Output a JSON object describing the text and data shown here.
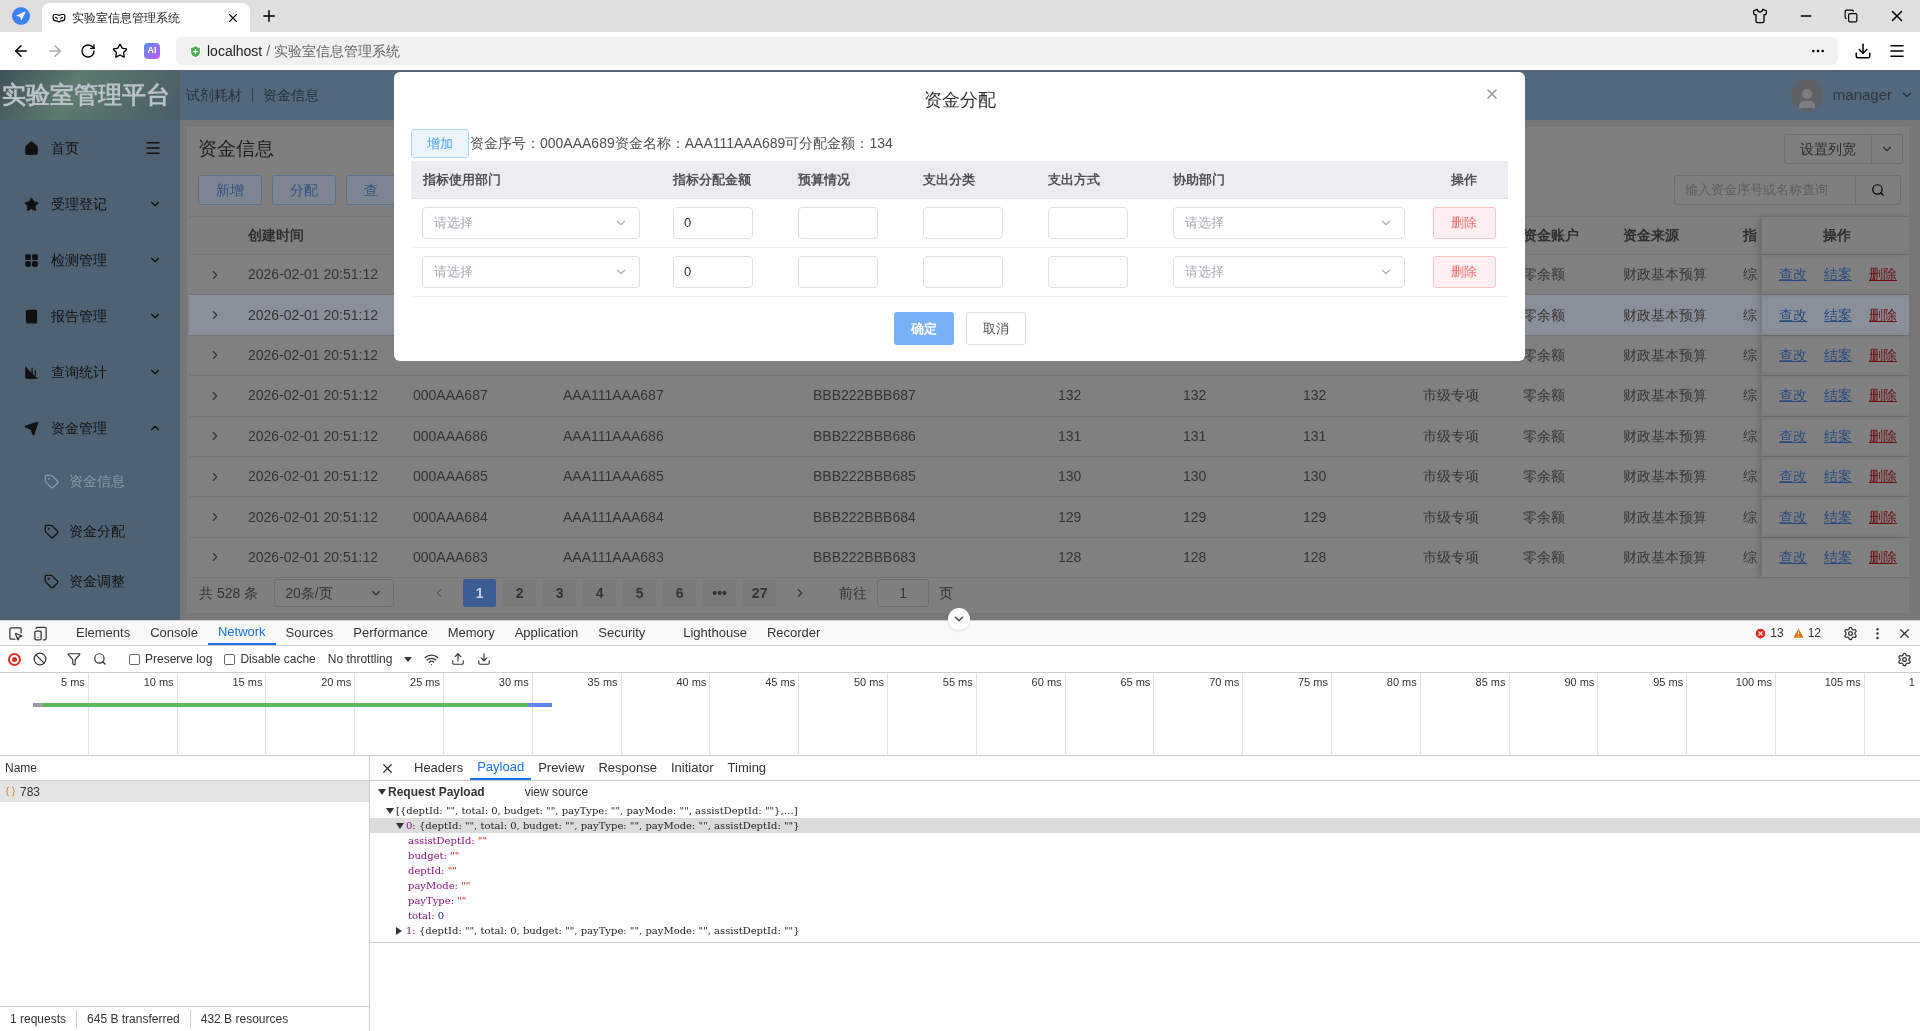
{
  "browser": {
    "tab_title": "实验室信息管理系统",
    "ai_badge": "AI",
    "address": {
      "host": "localhost",
      "path": " / 实验室信息管理系统"
    }
  },
  "app": {
    "logo": "实验室管理平台",
    "breadcrumbs": [
      "试剂耗材",
      "资金信息"
    ],
    "user": "manager",
    "sidebar": [
      {
        "label": "首页"
      },
      {
        "label": "受理登记",
        "expanded": false
      },
      {
        "label": "检测管理",
        "expanded": false
      },
      {
        "label": "报告管理",
        "expanded": false
      },
      {
        "label": "查询统计",
        "expanded": false
      },
      {
        "label": "资金管理",
        "expanded": true,
        "children": [
          {
            "label": "资金信息",
            "selected": true
          },
          {
            "label": "资金分配",
            "selected": false
          },
          {
            "label": "资金调整",
            "selected": false
          }
        ]
      }
    ],
    "page_title": "资金信息",
    "toolbar": [
      "新增",
      "分配",
      "查"
    ],
    "column_width_button": "设置列宽",
    "search": {
      "placeholder": "输入资金序号或名称查询"
    },
    "table": {
      "columns": [
        "创建时间",
        null,
        null,
        null,
        null,
        null,
        null,
        null,
        "资金账户",
        "资金来源",
        "指"
      ],
      "actions_header": "操作",
      "rows": [
        {
          "expanded": false,
          "highlighted": false,
          "cells": [
            "2026-02-01 20:51:12",
            null,
            null,
            null,
            null,
            null,
            null,
            null,
            "零余额",
            "财政基本预算",
            "综"
          ],
          "actions": [
            {
              "label": "查改",
              "kind": "link"
            },
            {
              "label": "结案",
              "kind": "link"
            },
            {
              "label": "删除",
              "kind": "danger"
            }
          ]
        },
        {
          "expanded": false,
          "highlighted": true,
          "cells": [
            "2026-02-01 20:51:12",
            null,
            null,
            null,
            null,
            null,
            null,
            null,
            "零余额",
            "财政基本预算",
            "综"
          ],
          "actions": [
            {
              "label": "查改",
              "kind": "link"
            },
            {
              "label": "结案",
              "kind": "link"
            },
            {
              "label": "删除",
              "kind": "danger"
            }
          ]
        },
        {
          "expanded": false,
          "highlighted": false,
          "cells": [
            "2026-02-01 20:51:12",
            null,
            null,
            null,
            null,
            null,
            null,
            null,
            "零余额",
            "财政基本预算",
            "综"
          ],
          "actions": [
            {
              "label": "查改",
              "kind": "link"
            },
            {
              "label": "结案",
              "kind": "link"
            },
            {
              "label": "删除",
              "kind": "danger"
            }
          ]
        },
        {
          "expanded": false,
          "highlighted": false,
          "cells": [
            "2026-02-01 20:51:12",
            "000AAA687",
            "AAA111AAA687",
            "BBB222BBB687",
            "132",
            "132",
            "132",
            "市级专项",
            "零余额",
            "财政基本预算",
            "综"
          ],
          "actions": [
            {
              "label": "查改",
              "kind": "link"
            },
            {
              "label": "结案",
              "kind": "link"
            },
            {
              "label": "删除",
              "kind": "danger"
            }
          ]
        },
        {
          "expanded": false,
          "highlighted": false,
          "cells": [
            "2026-02-01 20:51:12",
            "000AAA686",
            "AAA111AAA686",
            "BBB222BBB686",
            "131",
            "131",
            "131",
            "市级专项",
            "零余额",
            "财政基本预算",
            "综"
          ],
          "actions": [
            {
              "label": "查改",
              "kind": "link"
            },
            {
              "label": "结案",
              "kind": "link"
            },
            {
              "label": "删除",
              "kind": "danger"
            }
          ]
        },
        {
          "expanded": false,
          "highlighted": false,
          "cells": [
            "2026-02-01 20:51:12",
            "000AAA685",
            "AAA111AAA685",
            "BBB222BBB685",
            "130",
            "130",
            "130",
            "市级专项",
            "零余额",
            "财政基本预算",
            "综"
          ],
          "actions": [
            {
              "label": "查改",
              "kind": "link"
            },
            {
              "label": "结案",
              "kind": "link"
            },
            {
              "label": "删除",
              "kind": "danger"
            }
          ]
        },
        {
          "expanded": false,
          "highlighted": false,
          "cells": [
            "2026-02-01 20:51:12",
            "000AAA684",
            "AAA111AAA684",
            "BBB222BBB684",
            "129",
            "129",
            "129",
            "市级专项",
            "零余额",
            "财政基本预算",
            "综"
          ],
          "actions": [
            {
              "label": "查改",
              "kind": "link"
            },
            {
              "label": "结案",
              "kind": "link"
            },
            {
              "label": "删除",
              "kind": "danger"
            }
          ]
        },
        {
          "expanded": false,
          "highlighted": false,
          "cells": [
            "2026-02-01 20:51:12",
            "000AAA683",
            "AAA111AAA683",
            "BBB222BBB683",
            "128",
            "128",
            "128",
            "市级专项",
            "零余额",
            "财政基本预算",
            "综"
          ],
          "actions": [
            {
              "label": "查改",
              "kind": "link"
            },
            {
              "label": "结案",
              "kind": "link"
            },
            {
              "label": "删除",
              "kind": "danger"
            }
          ]
        }
      ]
    },
    "pagination": {
      "total": "共 528 条",
      "page_size": "20条/页",
      "pages": [
        {
          "label": "1",
          "selected": true
        },
        {
          "label": "2",
          "selected": false
        },
        {
          "label": "3",
          "selected": false
        },
        {
          "label": "4",
          "selected": false
        },
        {
          "label": "5",
          "selected": false
        },
        {
          "label": "6",
          "selected": false
        },
        {
          "label": "•••",
          "selected": false
        },
        {
          "label": "27",
          "selected": false
        }
      ],
      "goto_label": "前往",
      "goto_value": "1",
      "goto_suffix": "页"
    }
  },
  "dialog": {
    "title": "资金分配",
    "add_button": "增加",
    "info": "资金序号：000AAA689资金名称：AAA111AAA689可分配金额：134",
    "columns": [
      "指标使用部门",
      "指标分配金额",
      "预算情况",
      "支出分类",
      "支出方式",
      "协助部门",
      "操作"
    ],
    "rows": [
      {
        "dept_placeholder": "请选择",
        "amount": "0",
        "assist_placeholder": "请选择",
        "delete": "删除"
      },
      {
        "dept_placeholder": "请选择",
        "amount": "0",
        "assist_placeholder": "请选择",
        "delete": "删除"
      }
    ],
    "buttons": [
      {
        "label": "确定",
        "kind": "primary"
      },
      {
        "label": "取消",
        "kind": "default"
      }
    ]
  },
  "devtools": {
    "tabs": [
      {
        "label": "Elements",
        "selected": false
      },
      {
        "label": "Console",
        "selected": false
      },
      {
        "label": "Network",
        "selected": true
      },
      {
        "label": "Sources",
        "selected": false
      },
      {
        "label": "Performance",
        "selected": false
      },
      {
        "label": "Memory",
        "selected": false
      },
      {
        "label": "Application",
        "selected": false
      },
      {
        "label": "Security",
        "selected": false
      },
      {
        "label": "Lighthouse",
        "selected": false
      },
      {
        "label": "Recorder",
        "selected": false
      }
    ],
    "errors": "13",
    "warnings": "12",
    "preserve_log": {
      "label": "Preserve log",
      "checked": false
    },
    "disable_cache": {
      "label": "Disable cache",
      "checked": false
    },
    "throttling": "No throttling",
    "timeline_ticks": [
      "5 ms",
      "10 ms",
      "15 ms",
      "20 ms",
      "25 ms",
      "30 ms",
      "35 ms",
      "40 ms",
      "45 ms",
      "50 ms",
      "55 ms",
      "60 ms",
      "65 ms",
      "70 ms",
      "75 ms",
      "80 ms",
      "85 ms",
      "90 ms",
      "95 ms",
      "100 ms",
      "105 ms",
      "1"
    ],
    "requests_header": "Name",
    "requests": [
      {
        "name": "783",
        "selected": true
      }
    ],
    "status": [
      "1 requests",
      "645 B transferred",
      "432 B resources"
    ],
    "detail_tabs": [
      {
        "label": "Headers",
        "selected": false
      },
      {
        "label": "Payload",
        "selected": true
      },
      {
        "label": "Preview",
        "selected": false
      },
      {
        "label": "Response",
        "selected": false
      },
      {
        "label": "Initiator",
        "selected": false
      },
      {
        "label": "Timing",
        "selected": false
      }
    ],
    "payload": {
      "title": "Request Payload",
      "expanded": true,
      "view_source": "view source",
      "tree": {
        "summary": "[{deptId: \"\", total: 0, budget: \"\", payType: \"\", payMode: \"\", assistDeptId: \"\"},…]",
        "expanded": true,
        "selected": false,
        "children": [
          {
            "key": "0:",
            "summary": "{deptId: \"\", total: 0, budget: \"\", payType: \"\", payMode: \"\", assistDeptId: \"\"}",
            "expanded": true,
            "selected": true,
            "children": [
              {
                "key": "assistDeptId:",
                "value": "\"\"",
                "kind": "string"
              },
              {
                "key": "budget:",
                "value": "\"\"",
                "kind": "string"
              },
              {
                "key": "deptId:",
                "value": "\"\"",
                "kind": "string"
              },
              {
                "key": "payMode:",
                "value": "\"\"",
                "kind": "string"
              },
              {
                "key": "payType:",
                "value": "\"\"",
                "kind": "string"
              },
              {
                "key": "total:",
                "value": "0",
                "kind": "number"
              }
            ]
          },
          {
            "key": "1:",
            "summary": "{deptId: \"\", total: 0, budget: \"\", payType: \"\", payMode: \"\", assistDeptId: \"\"}",
            "expanded": false,
            "selected": false
          }
        ]
      }
    }
  }
}
